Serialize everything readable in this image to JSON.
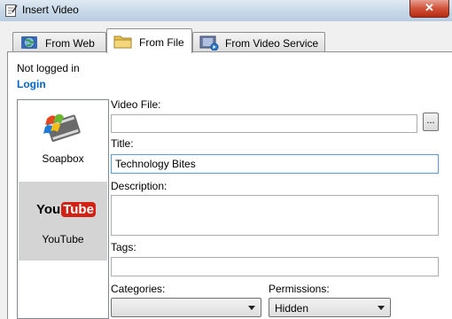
{
  "window": {
    "title": "Insert Video",
    "close_glyph": "✕"
  },
  "tabs": [
    {
      "label": "From Web",
      "icon": "globe-icon"
    },
    {
      "label": "From File",
      "icon": "folder-icon"
    },
    {
      "label": "From Video Service",
      "icon": "film-icon"
    }
  ],
  "active_tab": "From File",
  "account": {
    "status": "Not logged in",
    "login_label": "Login"
  },
  "services": [
    {
      "label": "Soapbox",
      "icon": "soapbox-logo"
    },
    {
      "label": "YouTube",
      "icon": "youtube-logo",
      "logo_text_a": "You",
      "logo_text_b": "Tube"
    }
  ],
  "selected_service": "YouTube",
  "form": {
    "video_file_label": "Video File:",
    "video_file_value": "",
    "browse_label": "...",
    "title_label": "Title:",
    "title_value": "Technology Bites",
    "description_label": "Description:",
    "description_value": "",
    "tags_label": "Tags:",
    "tags_value": "",
    "categories_label": "Categories:",
    "categories_value": "",
    "permissions_label": "Permissions:",
    "permissions_value": "Hidden"
  },
  "colors": {
    "link": "#0066cc",
    "focus_border": "#569de5",
    "youtube_red": "#d22215"
  }
}
